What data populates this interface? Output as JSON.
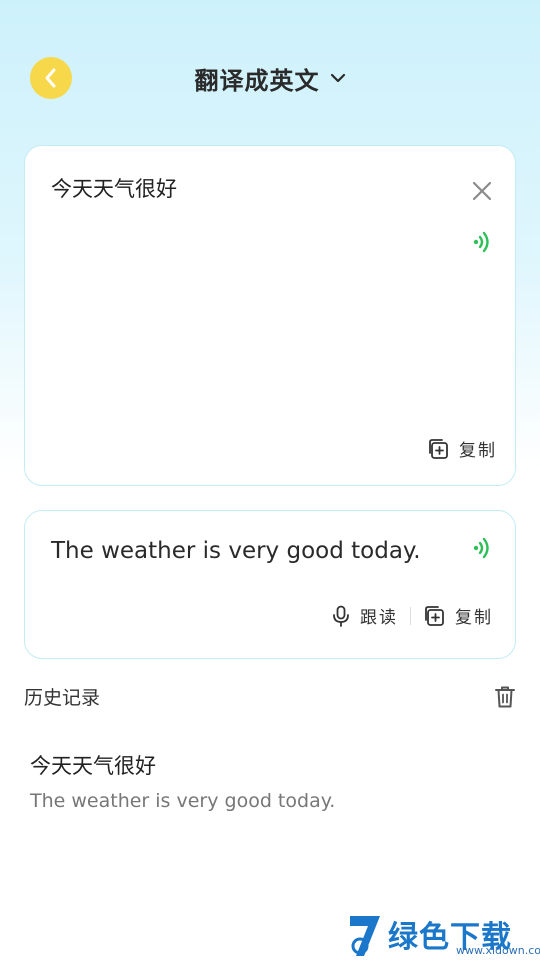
{
  "header": {
    "title": "翻译成英文"
  },
  "input_card": {
    "text": "今天天气很好",
    "copy_label": "复制"
  },
  "output_card": {
    "text": "The weather is very good today.",
    "read_label": "跟读",
    "copy_label": "复制"
  },
  "history": {
    "title": "历史记录",
    "items": [
      {
        "source": "今天天气很好",
        "translation": "The weather is very good today."
      }
    ]
  },
  "watermark": {
    "text": "绿色下载站",
    "url": "www.xldown.com"
  },
  "colors": {
    "accent_yellow": "#f7d84a",
    "speaker_green": "#2fbf5a",
    "card_border": "#c3ecf6",
    "bg_top": "#cdf1fb"
  },
  "icons": {
    "back": "chevron-left-icon",
    "dropdown": "chevron-down-icon",
    "close": "close-icon",
    "speaker": "speaker-icon",
    "copy": "copy-icon",
    "mic": "microphone-icon",
    "trash": "trash-icon"
  }
}
